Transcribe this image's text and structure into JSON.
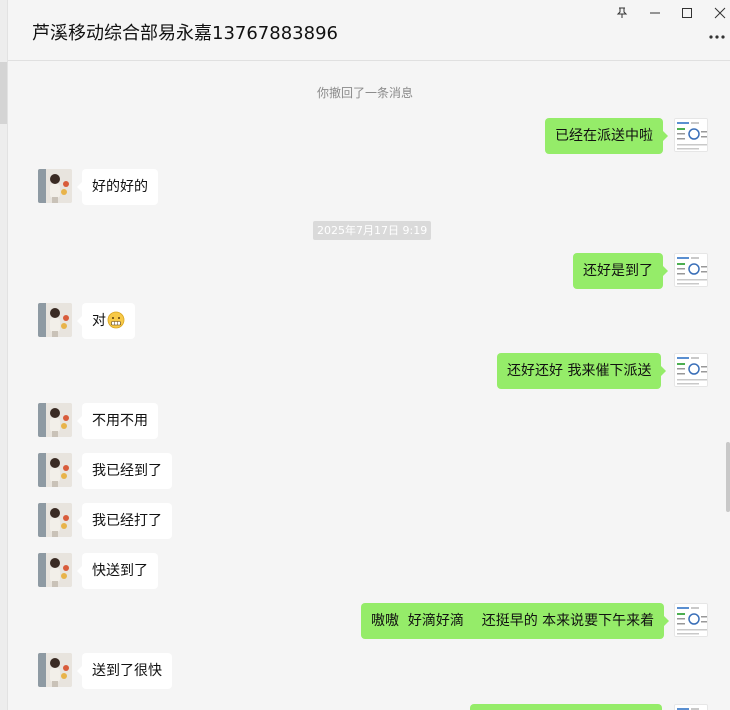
{
  "window": {
    "title": "芦溪移动综合部易永嘉13767883896",
    "buttons": [
      "pin-icon",
      "minimize-icon",
      "maximize-icon",
      "close-icon",
      "more-icon"
    ]
  },
  "messages": [
    {
      "kind": "system",
      "text": "你撤回了一条消息"
    },
    {
      "kind": "sent",
      "text": "已经在派送中啦"
    },
    {
      "kind": "received",
      "text": "好的好的"
    },
    {
      "kind": "time",
      "text": "2025年7月17日 9:19"
    },
    {
      "kind": "sent",
      "text": "还好是到了"
    },
    {
      "kind": "received",
      "text": "对",
      "emoji": "grimace-emoji"
    },
    {
      "kind": "sent",
      "text": "还好还好 我来催下派送"
    },
    {
      "kind": "received",
      "text": "不用不用"
    },
    {
      "kind": "received",
      "text": "我已经到了"
    },
    {
      "kind": "received",
      "text": "我已经打了"
    },
    {
      "kind": "received",
      "text": "快送到了"
    },
    {
      "kind": "sent",
      "text": "嗷嗷  好滴好滴    还挺早的 本来说要下午来着"
    },
    {
      "kind": "received",
      "text": "送到了很快"
    },
    {
      "kind": "sent",
      "text": ""
    }
  ],
  "colors": {
    "background": "#f5f5f5",
    "sent_bubble": "#95ec69",
    "received_bubble": "#ffffff",
    "system_text": "#8a8a8a",
    "time_chip": "#dadada"
  }
}
